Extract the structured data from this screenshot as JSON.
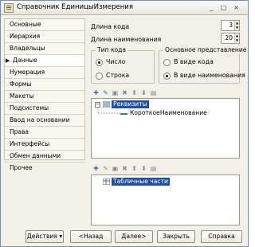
{
  "window": {
    "title": "Справочник ЕдиницыИзмерения",
    "minimize_glyph": "_",
    "maximize_glyph": "□",
    "close_glyph": "×"
  },
  "sidebar": {
    "items": [
      {
        "label": "Основные"
      },
      {
        "label": "Иерархия"
      },
      {
        "label": "Владельцы"
      },
      {
        "label": "Данные",
        "active": true
      },
      {
        "label": "Нумерация"
      },
      {
        "label": "Формы"
      },
      {
        "label": "Макеты"
      },
      {
        "label": "Подсистемы"
      },
      {
        "label": "Ввод на основании"
      },
      {
        "label": "Права"
      },
      {
        "label": "Интерфейсы"
      },
      {
        "label": "Обмен данными"
      },
      {
        "label": "Прочее"
      }
    ]
  },
  "fields": {
    "code_length_label": "Длина кода",
    "code_length_value": "3",
    "name_length_label": "Длина наименования",
    "name_length_value": "20"
  },
  "code_type": {
    "title": "Тип кода",
    "options": [
      {
        "label": "Число",
        "selected": true
      },
      {
        "label": "Строка",
        "selected": false
      }
    ]
  },
  "main_representation": {
    "title": "Основное представление",
    "options": [
      {
        "label": "В виде кода",
        "selected": false
      },
      {
        "label": "В виде наименования",
        "selected": true
      }
    ]
  },
  "attributes_tree": {
    "root": "Реквизиты",
    "child": "КороткоеНаименование"
  },
  "tabular_tree": {
    "root": "Табличные части"
  },
  "buttons": {
    "actions": "Действия",
    "back": "<Назад",
    "next": "Далее>",
    "close": "Закрыть",
    "help": "Справка"
  },
  "icons": {
    "sidebar_arrow": "▶",
    "dropdown_arrow": "▾",
    "expand_minus": "−"
  }
}
